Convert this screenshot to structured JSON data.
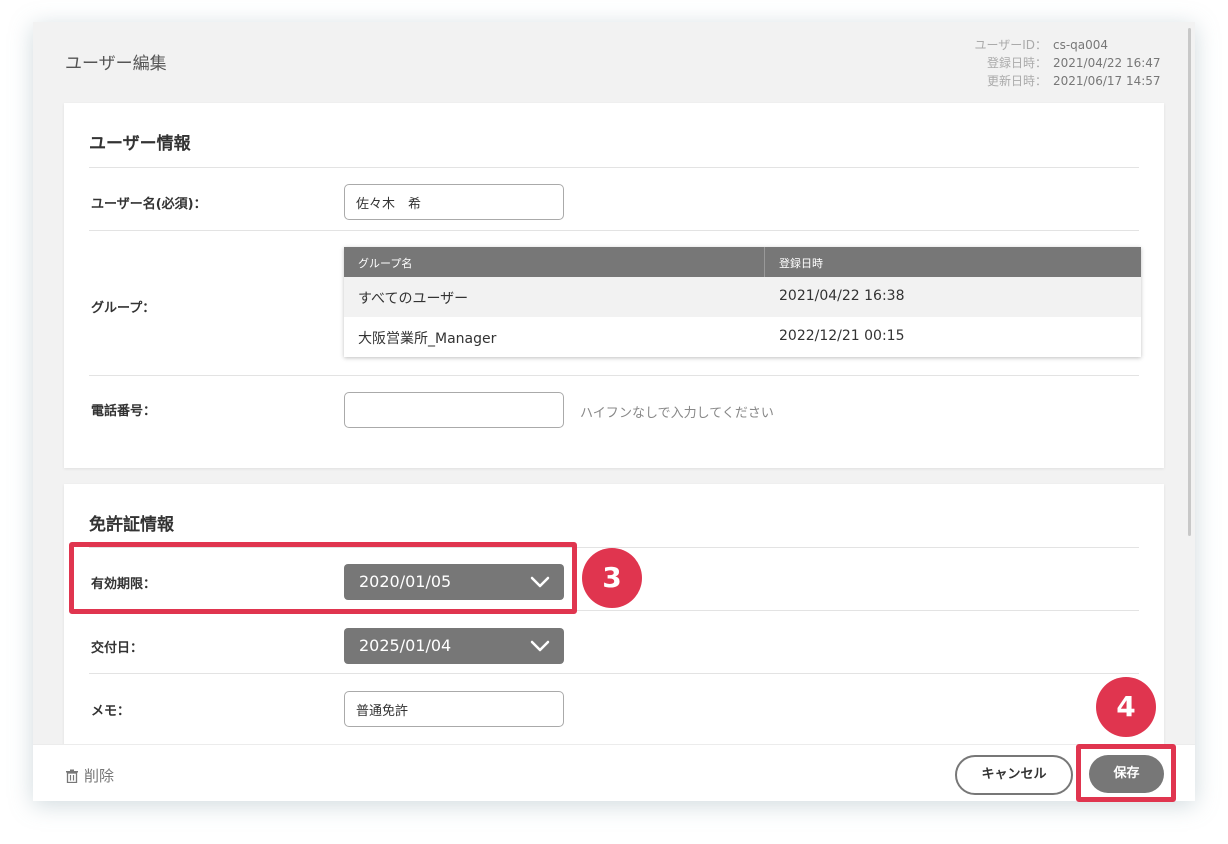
{
  "header": {
    "title": "ユーザー編集",
    "meta": [
      {
        "label": "ユーザーID：",
        "value": "cs-qa004"
      },
      {
        "label": "登録日時：",
        "value": "2021/04/22 16:47"
      },
      {
        "label": "更新日時：",
        "value": "2021/06/17 14:57"
      }
    ]
  },
  "user_info": {
    "title": "ユーザー情報",
    "name_label": "ユーザー名(必須)：",
    "name_value": "佐々木　希",
    "group_label": "グループ：",
    "group_table": {
      "headers": [
        "グループ名",
        "登録日時"
      ],
      "rows": [
        {
          "name": "すべてのユーザー",
          "date": "2021/04/22 16:38"
        },
        {
          "name": "大阪営業所_Manager",
          "date": "2022/12/21 00:15"
        }
      ]
    },
    "phone_label": "電話番号：",
    "phone_value": "",
    "phone_hint": "ハイフンなしで入力してください"
  },
  "license_info": {
    "title": "免許証情報",
    "expiry_label": "有効期限：",
    "expiry_value": "2020/01/05",
    "issue_label": "交付日：",
    "issue_value": "2025/01/04",
    "memo_label": "メモ：",
    "memo_value": "普通免許"
  },
  "annotations": {
    "step3": "3",
    "step4": "4",
    "highlight_color": "#e0354f"
  },
  "footer": {
    "delete_label": "削除",
    "cancel_label": "キャンセル",
    "save_label": "保存"
  },
  "colors": {
    "accent_gray": "#777777",
    "highlight": "#e0354f"
  }
}
